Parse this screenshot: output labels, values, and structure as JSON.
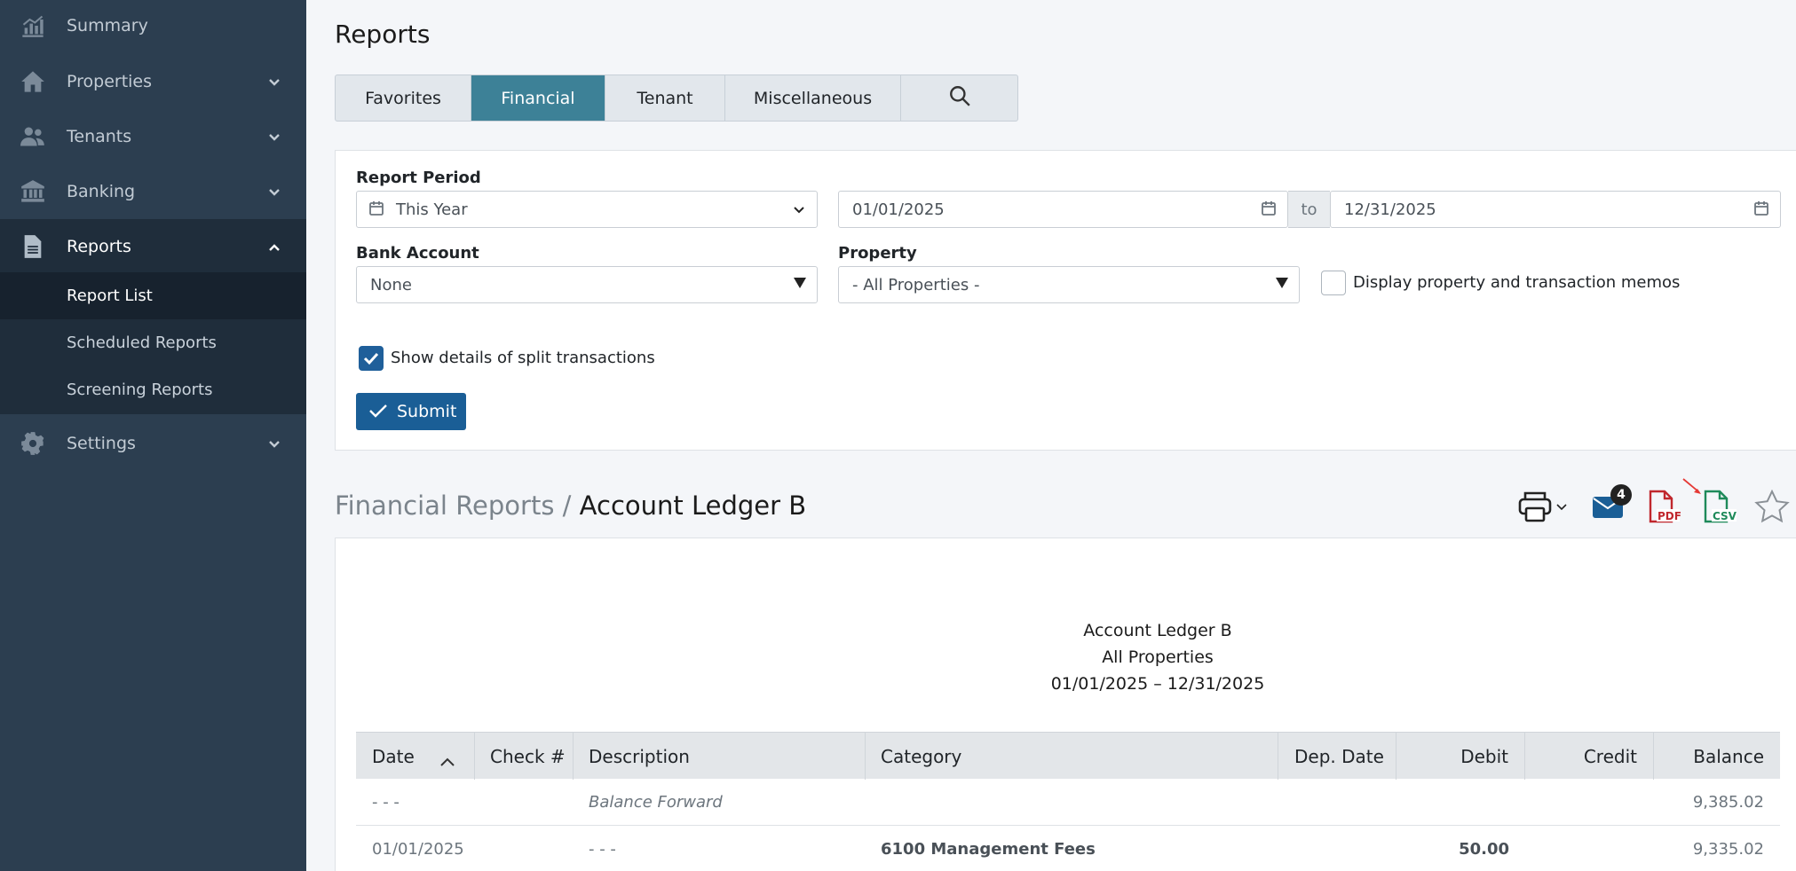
{
  "sidebar": {
    "items": [
      {
        "label": "Summary",
        "icon": "chart-icon"
      },
      {
        "label": "Properties",
        "icon": "home-icon"
      },
      {
        "label": "Tenants",
        "icon": "users-icon"
      },
      {
        "label": "Banking",
        "icon": "bank-icon"
      },
      {
        "label": "Reports",
        "icon": "document-icon"
      },
      {
        "label": "Settings",
        "icon": "gear-icon"
      }
    ],
    "reports_submenu": [
      "Report List",
      "Scheduled Reports",
      "Screening Reports"
    ]
  },
  "page": {
    "title": "Reports"
  },
  "tabs": [
    {
      "label": "Favorites"
    },
    {
      "label": "Financial"
    },
    {
      "label": "Tenant"
    },
    {
      "label": "Miscellaneous"
    }
  ],
  "filters": {
    "report_period_label": "Report Period",
    "report_period_value": "This Year",
    "start_date": "01/01/2025",
    "to_label": "to",
    "end_date": "12/31/2025",
    "bank_account_label": "Bank Account",
    "bank_account_value": "None",
    "property_label": "Property",
    "property_value": "- All Properties -",
    "memos_label": "Display property and transaction memos",
    "split_label": "Show details of split transactions",
    "submit_label": "Submit"
  },
  "breadcrumb": {
    "parent": "Financial Reports",
    "separator": " / ",
    "current": "Account Ledger B"
  },
  "toolbar": {
    "email_count": "4"
  },
  "report": {
    "title": "Account Ledger B",
    "subtitle": "All Properties",
    "date_range": "01/01/2025 – 12/31/2025",
    "columns": [
      "Date",
      "Check #",
      "Description",
      "Category",
      "Dep. Date",
      "Debit",
      "Credit",
      "Balance"
    ],
    "rows": [
      {
        "date": "- - -",
        "check": "",
        "description": "Balance Forward",
        "category": "",
        "dep_date": "",
        "debit": "",
        "credit": "",
        "balance": "9,385.02"
      },
      {
        "date": "01/01/2025",
        "check": "- - -",
        "description": "",
        "category": "6100 Management Fees",
        "dep_date": "",
        "debit": "50.00",
        "credit": "",
        "balance": "9,335.02"
      }
    ]
  },
  "colors": {
    "sidebar": "#2c3e50",
    "accent_tab": "#3d8197",
    "primary_button": "#1a5e96",
    "pdf_red": "#c0272d",
    "csv_green": "#1e8a5a"
  }
}
